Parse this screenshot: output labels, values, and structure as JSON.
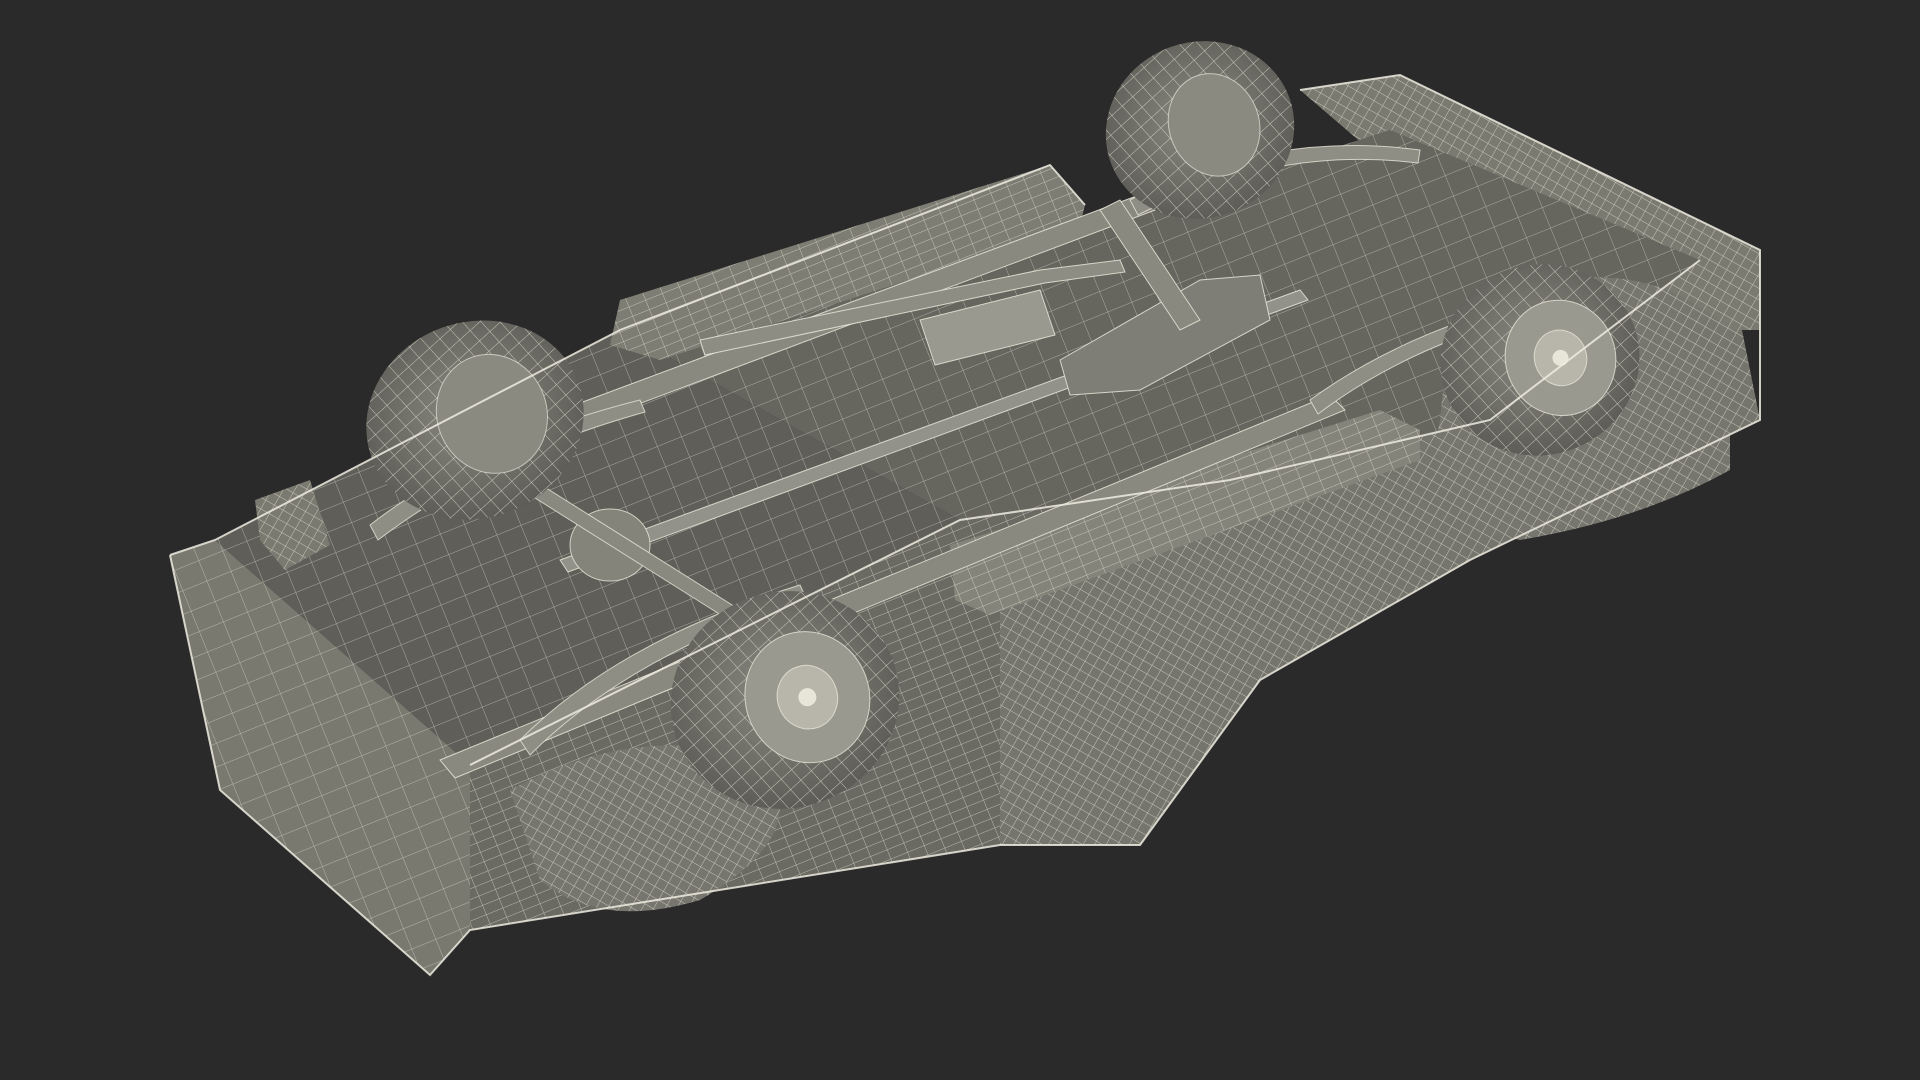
{
  "scene": {
    "background_color": "#2a2a2a",
    "model_fill": "#6e6d66",
    "model_fill_light": "#8a897f",
    "model_fill_dark": "#56554f",
    "wire_color": "#e8e6d8",
    "subject": "wireframe-vehicle-underside"
  }
}
